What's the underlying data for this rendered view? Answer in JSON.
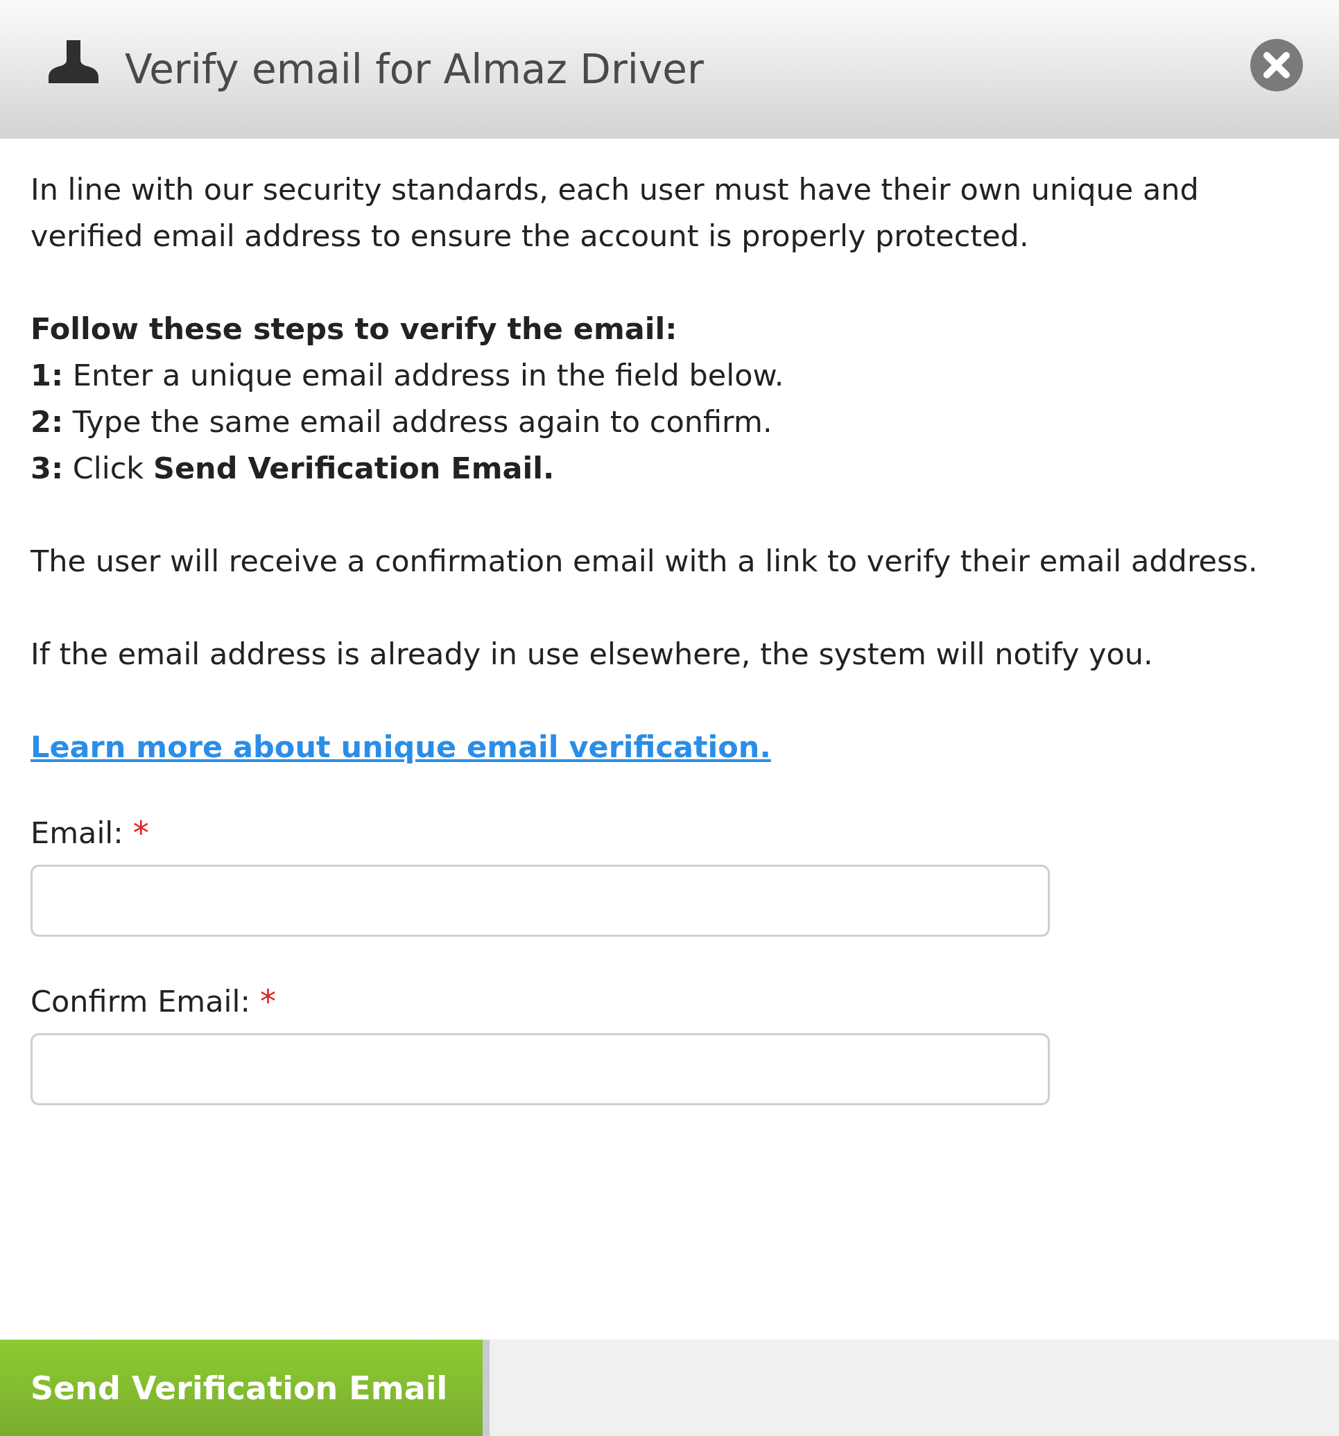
{
  "window": {
    "title": "Verify email for Almaz Driver"
  },
  "intro": "In line with our security standards, each user must have their own unique and verified email address to ensure the account is properly protected.",
  "steps_heading": "Follow these steps to verify the email:",
  "steps": [
    {
      "number": "1:",
      "text": "Enter a unique email address in the field below."
    },
    {
      "number": "2:",
      "text": "Type the same email address again to confirm."
    },
    {
      "number": "3:",
      "text": "Click **Send Verification Email.**"
    }
  ],
  "paragraphs": [
    "The user will receive a confirmation email with a link to verify their email address.",
    "If the email address is already in use elsewhere, the system will notify you."
  ],
  "link": "Learn more about unique email verification.",
  "fields": [
    {
      "label": "Email:",
      "required": true,
      "required_mark": "*"
    },
    {
      "label": "Confirm Email:",
      "required": true,
      "required_mark": "*"
    }
  ],
  "buttons": [
    {
      "label": "Send Verification Email",
      "kind": "primary"
    }
  ]
}
